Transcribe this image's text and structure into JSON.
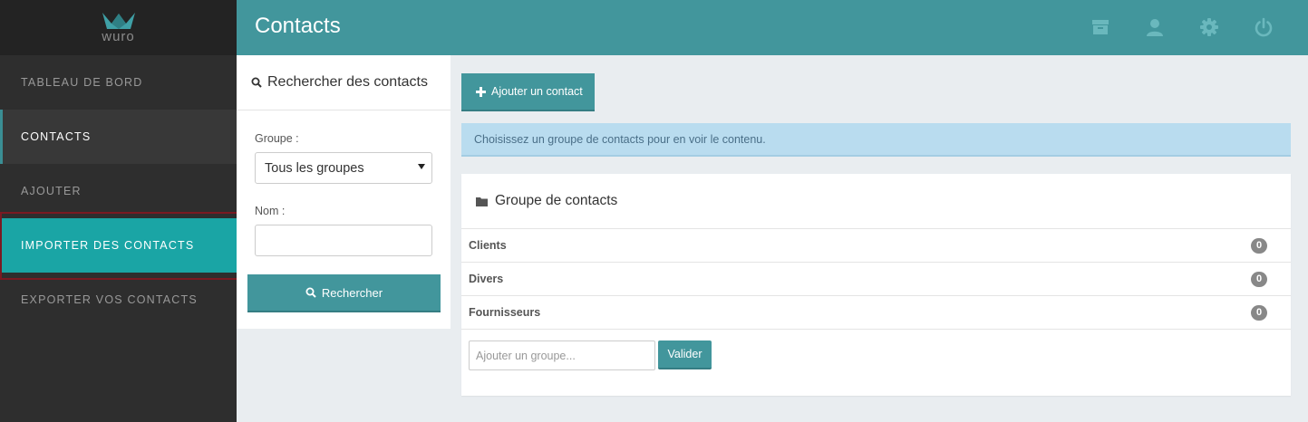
{
  "app": {
    "logo_text": "wuro"
  },
  "colors": {
    "brand": "#42969c",
    "active": "#1aa5a5",
    "sidebar": "#2e2e2e"
  },
  "sidebar": {
    "items": [
      {
        "label": "TABLEAU DE BORD"
      },
      {
        "label": "CONTACTS"
      },
      {
        "label": "AJOUTER"
      },
      {
        "label": "IMPORTER DES CONTACTS"
      },
      {
        "label": "EXPORTER VOS CONTACTS"
      }
    ]
  },
  "header": {
    "title": "Contacts",
    "icons": [
      "archive-icon",
      "user-icon",
      "gear-icon",
      "power-icon"
    ]
  },
  "search": {
    "title": "Rechercher des contacts",
    "group_label": "Groupe :",
    "group_value": "Tous les groupes",
    "name_label": "Nom :",
    "name_value": "",
    "button_label": "Rechercher"
  },
  "main": {
    "add_button": "Ajouter un contact",
    "alert": "Choisissez un groupe de contacts pour en voir le contenu."
  },
  "groups": {
    "title": "Groupe de contacts",
    "items": [
      {
        "name": "Clients",
        "count": "0"
      },
      {
        "name": "Divers",
        "count": "0"
      },
      {
        "name": "Fournisseurs",
        "count": "0"
      }
    ],
    "add_placeholder": "Ajouter un groupe...",
    "submit_label": "Valider"
  }
}
